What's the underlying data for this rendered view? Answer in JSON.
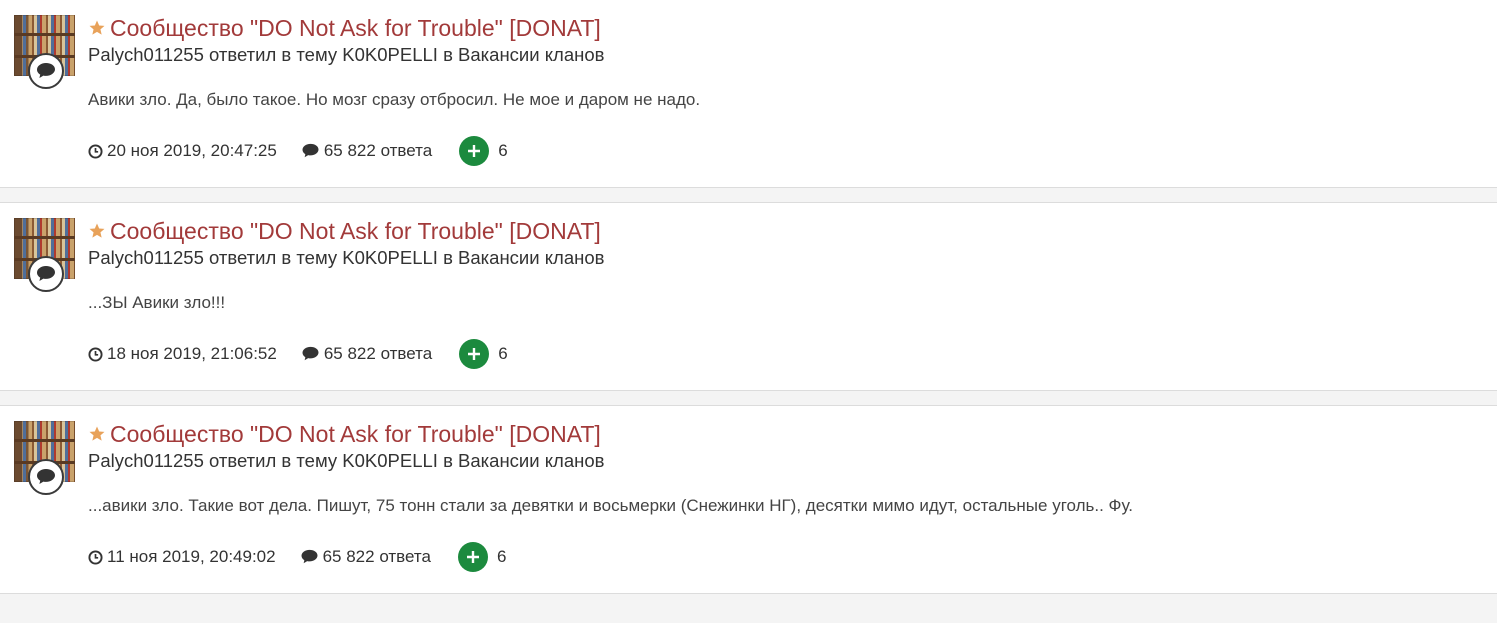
{
  "colors": {
    "title": "#a23a3a",
    "star": "#e8a25a",
    "reputation_button": "#1c8a3e",
    "separator": "#f4f4f4"
  },
  "items": [
    {
      "title": "Сообщество \"DO Not Ask for Trouble\" [DONAT]",
      "author": "Palych011255",
      "verb": "ответил в тему",
      "topic": "K0K0PELLI",
      "in": "в",
      "forum": "Вакансии кланов",
      "snippet": "Авики зло. Да, было такое. Но мозг сразу отбросил. Не мое и даром не надо.",
      "date": "20 ноя 2019, 20:47:25",
      "replies": "65 822 ответа",
      "reputation": "6"
    },
    {
      "title": "Сообщество \"DO Not Ask for Trouble\" [DONAT]",
      "author": "Palych011255",
      "verb": "ответил в тему",
      "topic": "K0K0PELLI",
      "in": "в",
      "forum": "Вакансии кланов",
      "snippet": "...ЗЫ Авики зло!!!",
      "date": "18 ноя 2019, 21:06:52",
      "replies": "65 822 ответа",
      "reputation": "6"
    },
    {
      "title": "Сообщество \"DO Not Ask for Trouble\" [DONAT]",
      "author": "Palych011255",
      "verb": "ответил в тему",
      "topic": "K0K0PELLI",
      "in": "в",
      "forum": "Вакансии кланов",
      "snippet": "...авики зло. Такие вот дела. Пишут, 75 тонн стали за девятки и восьмерки (Снежинки НГ), десятки мимо идут, остальные уголь.. Фу.",
      "date": "11 ноя 2019, 20:49:02",
      "replies": "65 822 ответа",
      "reputation": "6"
    }
  ]
}
